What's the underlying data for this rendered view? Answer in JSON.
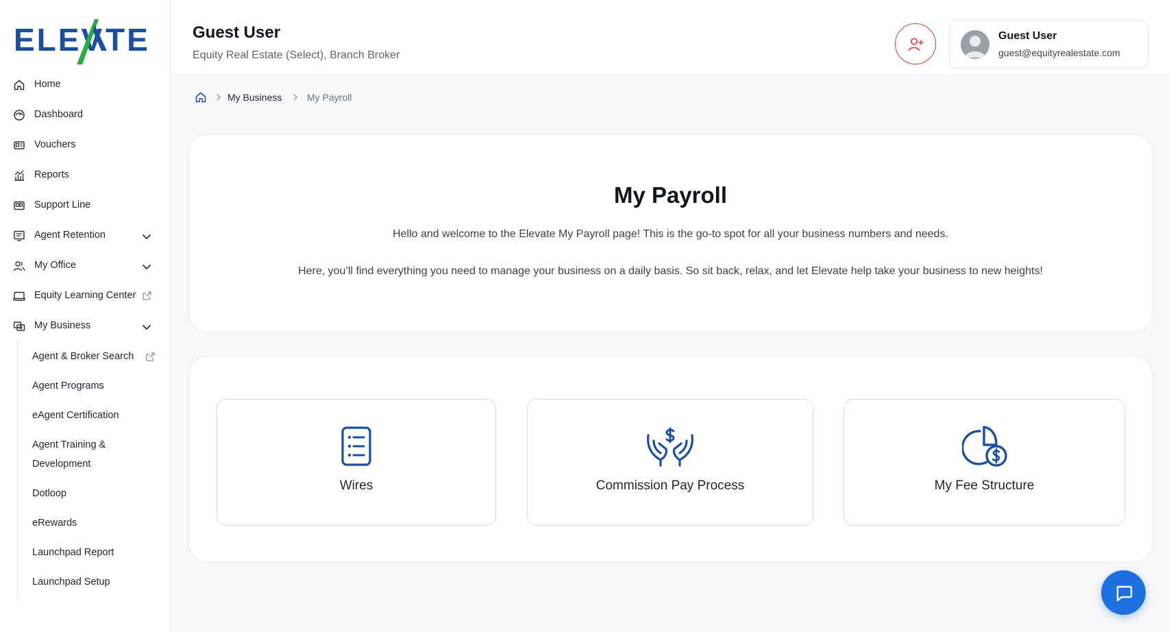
{
  "brand": {
    "logo_text": "ELEVATE",
    "primary_color": "#1a4fa0",
    "accent_color": "#27ae3f"
  },
  "sidebar": {
    "items": [
      {
        "label": "Home",
        "icon": "home-icon"
      },
      {
        "label": "Dashboard",
        "icon": "dashboard-icon"
      },
      {
        "label": "Vouchers",
        "icon": "voucher-icon"
      },
      {
        "label": "Reports",
        "icon": "reports-icon"
      },
      {
        "label": "Support Line",
        "icon": "support-icon"
      },
      {
        "label": "Agent Retention",
        "icon": "retention-icon",
        "expandable": true
      },
      {
        "label": "My Office",
        "icon": "users-icon",
        "expandable": true
      },
      {
        "label": "Equity Learning Center",
        "icon": "learning-icon",
        "external": true
      },
      {
        "label": "My Business",
        "icon": "business-icon",
        "expandable": true,
        "expanded": true
      }
    ],
    "sub_items": [
      {
        "label": "Agent & Broker Search",
        "external": true
      },
      {
        "label": "Agent Programs"
      },
      {
        "label": "eAgent Certification"
      },
      {
        "label": "Agent Training &"
      },
      {
        "label": "Development"
      },
      {
        "label": "Dotloop"
      },
      {
        "label": "eRewards"
      },
      {
        "label": "Launchpad Report"
      },
      {
        "label": "Launchpad Setup"
      }
    ]
  },
  "header": {
    "title": "Guest User",
    "subtitle": "Equity Real Estate (Select), Branch Broker",
    "profile": {
      "name": "Guest User",
      "email": "guest@equityrealestate.com"
    }
  },
  "breadcrumb": {
    "items": [
      "My Business",
      "My Payroll"
    ]
  },
  "main": {
    "title": "My Payroll",
    "intro_1": "Hello and welcome to the Elevate My Payroll page!  This is the go-to spot for all your business numbers and needs.",
    "intro_2": "Here, you’ll find everything you need to manage your business on a daily basis. So sit back, relax, and let Elevate help take your business to new heights!",
    "tiles": [
      {
        "label": "Wires",
        "icon": "list-document-icon"
      },
      {
        "label": "Commission Pay Process",
        "icon": "hands-dollar-icon"
      },
      {
        "label": "My Fee Structure",
        "icon": "pie-dollar-icon"
      }
    ]
  },
  "chat": {
    "icon": "chat-icon"
  }
}
